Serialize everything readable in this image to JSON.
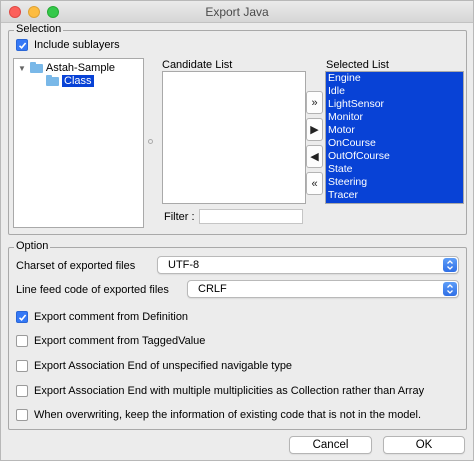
{
  "window": {
    "title": "Export Java"
  },
  "selection": {
    "legend": "Selection",
    "include_sublayers": {
      "label": "Include sublayers",
      "checked": true
    },
    "tree": [
      {
        "label": "Astah-Sample",
        "expanded": true
      },
      {
        "label": "Class",
        "selected": true
      }
    ],
    "candidate_list_label": "Candidate List",
    "selected_list_label": "Selected List",
    "selected_items": [
      "Engine",
      "Idle",
      "LightSensor",
      "Monitor",
      "Motor",
      "OnCourse",
      "OutOfCourse",
      "State",
      "Steering",
      "Tracer"
    ],
    "move_buttons": [
      "»",
      "▶",
      "◀",
      "«"
    ],
    "filter_label": "Filter :",
    "filter_value": ""
  },
  "option": {
    "legend": "Option",
    "charset_label": "Charset of exported files",
    "charset_value": "UTF-8",
    "linefeed_label": "Line feed code of exported files",
    "linefeed_value": "CRLF",
    "checkboxes": [
      {
        "label": "Export comment from Definition",
        "checked": true
      },
      {
        "label": "Export comment from TaggedValue",
        "checked": false
      },
      {
        "label": "Export Association End of unspecified navigable type",
        "checked": false
      },
      {
        "label": "Export Association End with multiple multiplicities as Collection rather than Array",
        "checked": false
      },
      {
        "label": "When overwriting, keep the information of existing code that is not in the model.",
        "checked": false
      }
    ]
  },
  "buttons": {
    "cancel": "Cancel",
    "ok": "OK"
  },
  "colors": {
    "accent": "#3478f6",
    "selection": "#0842d6"
  }
}
